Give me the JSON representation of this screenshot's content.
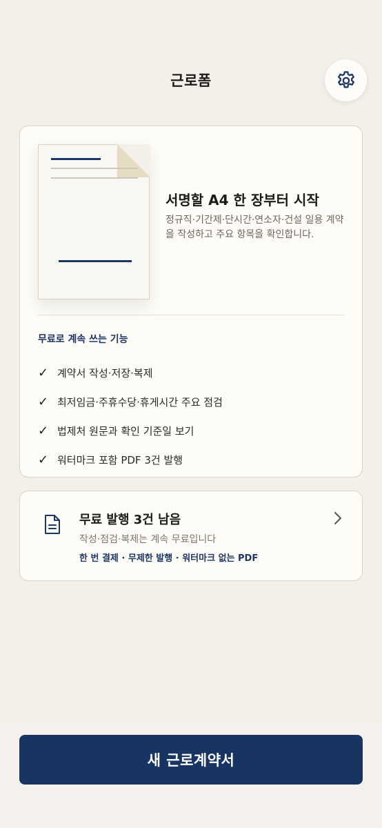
{
  "header": {
    "title": "근로폼",
    "settings_icon": "gear-icon"
  },
  "hero": {
    "title": "서명할 A4 한 장부터 시작",
    "description": "정규직·기간제·단시간·연소자·건설 일용 계약을 작성하고 주요 항목을 확인합니다."
  },
  "features": {
    "title": "무료로 계속 쓰는 기능",
    "items": [
      "계약서 작성·저장·복제",
      "최저임금·주휴수당·휴게시간 주요 점검",
      "법제처 원문과 확인 기준일 보기",
      "워터마크 포함 PDF 3건 발행"
    ],
    "check_icon": "✓"
  },
  "free_card": {
    "icon": "document-icon",
    "title": "무료 발행 3건 남음",
    "subtitle": "작성·점검·복제는 계속 무료입니다",
    "note": "한 번 결제 · 무제한 발행 · 워터마크 없는 PDF"
  },
  "cta": {
    "label": "새 근로계약서"
  },
  "colors": {
    "background": "#f4efe8",
    "accent": "#183462"
  }
}
